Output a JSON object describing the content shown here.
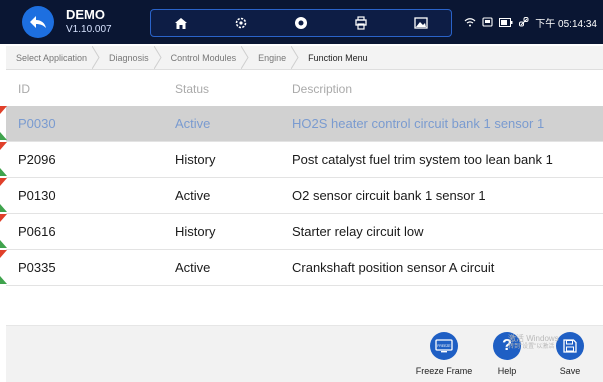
{
  "header": {
    "title": "DEMO",
    "version": "V1.10.007",
    "time": "下午 05:14:34"
  },
  "breadcrumb": [
    "Select Application",
    "Diagnosis",
    "Control Modules",
    "Engine",
    "Function Menu"
  ],
  "table": {
    "columns": {
      "id": "ID",
      "status": "Status",
      "description": "Description"
    },
    "rows": [
      {
        "id": "P0030",
        "status": "Active",
        "description": "HO2S heater control circuit bank 1  sensor 1",
        "selected": true
      },
      {
        "id": "P2096",
        "status": "History",
        "description": "Post catalyst fuel trim system too lean bank 1"
      },
      {
        "id": "P0130",
        "status": "Active",
        "description": "O2 sensor circuit bank 1 sensor 1"
      },
      {
        "id": "P0616",
        "status": "History",
        "description": "Starter relay circuit low"
      },
      {
        "id": "P0335",
        "status": "Active",
        "description": "Crankshaft position sensor A circuit"
      }
    ]
  },
  "actions": {
    "freeze_frame": "Freeze Frame",
    "help": "Help",
    "save": "Save",
    "freeze_icon_text": "FREEZE"
  },
  "watermark": {
    "line1": "激活 Windows",
    "line2": "转到\"设置\"以激活"
  },
  "colors": {
    "accent": "#1f5fc4",
    "topbar": "#0a1633",
    "selected_row": "#d1d1d1",
    "selected_text": "#7a9bd0"
  }
}
